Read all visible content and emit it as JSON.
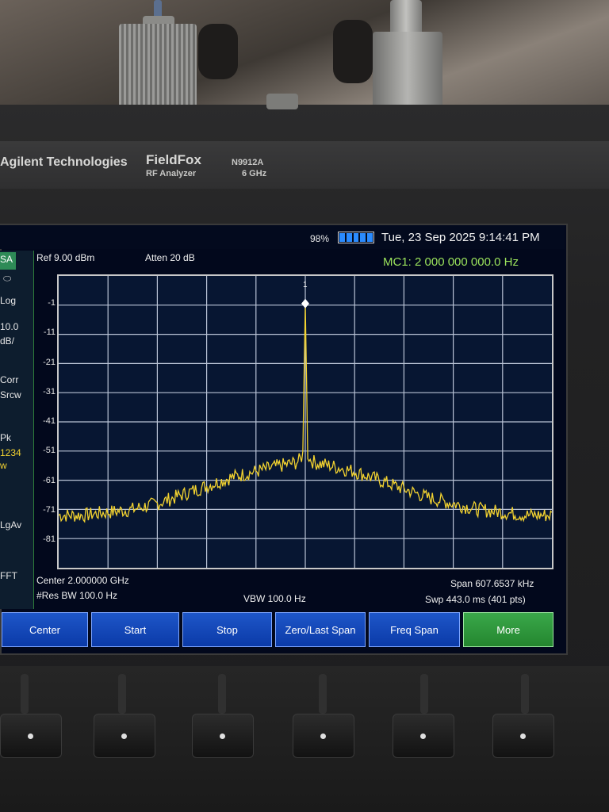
{
  "device": {
    "brand": "Agilent Technologies",
    "product": "FieldFox",
    "subtitle": "RF Analyzer",
    "model": "N9912A",
    "range": "6 GHz"
  },
  "status": {
    "battery_pct": "98%",
    "datetime": "Tue, 23 Sep 2025 9:14:41 PM"
  },
  "left_panel": {
    "mode": "SA",
    "items": [
      "Log",
      "10.0",
      "dB/",
      "Corr",
      "Srcw",
      "Pk",
      "1234",
      "w",
      "LgAv",
      "FFT"
    ]
  },
  "header": {
    "ref": "Ref 9.00 dBm",
    "atten": "Atten 20 dB",
    "marker_readout": "MC1:  2 000 000 000.0 Hz",
    "marker_label": "1"
  },
  "chart_data": {
    "type": "line",
    "ylim": [
      -91,
      9
    ],
    "y_ticks": [
      "-1",
      "-11",
      "-21",
      "-31",
      "-41",
      "-51",
      "-61",
      "-71",
      "-81"
    ],
    "x_range": "Center 2.000000 GHz, Span 607.6537 kHz",
    "grid": true,
    "series": [
      {
        "color": "#f2d230",
        "x": [
          0,
          0.05,
          0.1,
          0.15,
          0.2,
          0.25,
          0.3,
          0.35,
          0.4,
          0.45,
          0.48,
          0.49,
          0.495,
          0.5,
          0.505,
          0.51,
          0.52,
          0.55,
          0.6,
          0.65,
          0.7,
          0.75,
          0.8,
          0.85,
          0.9,
          0.95,
          1
        ],
        "y": [
          -73,
          -73,
          -72,
          -71,
          -69,
          -66,
          -63,
          -60,
          -58,
          -56,
          -55,
          -54,
          -52,
          -1,
          -52,
          -54,
          -55,
          -56,
          -58,
          -61,
          -64,
          -67,
          -69,
          -71,
          -72,
          -73,
          -73
        ]
      }
    ]
  },
  "footer": {
    "center": "Center 2.000000 GHz",
    "rbw": "#Res BW 100.0  Hz",
    "vbw": "VBW 100.0  Hz",
    "span": "Span 607.6537 kHz",
    "sweep": "Swp 443.0 ms (401 pts)"
  },
  "softkeys": [
    "Center",
    "Start",
    "Stop",
    "Zero/Last Span",
    "Freq Span",
    "More"
  ]
}
